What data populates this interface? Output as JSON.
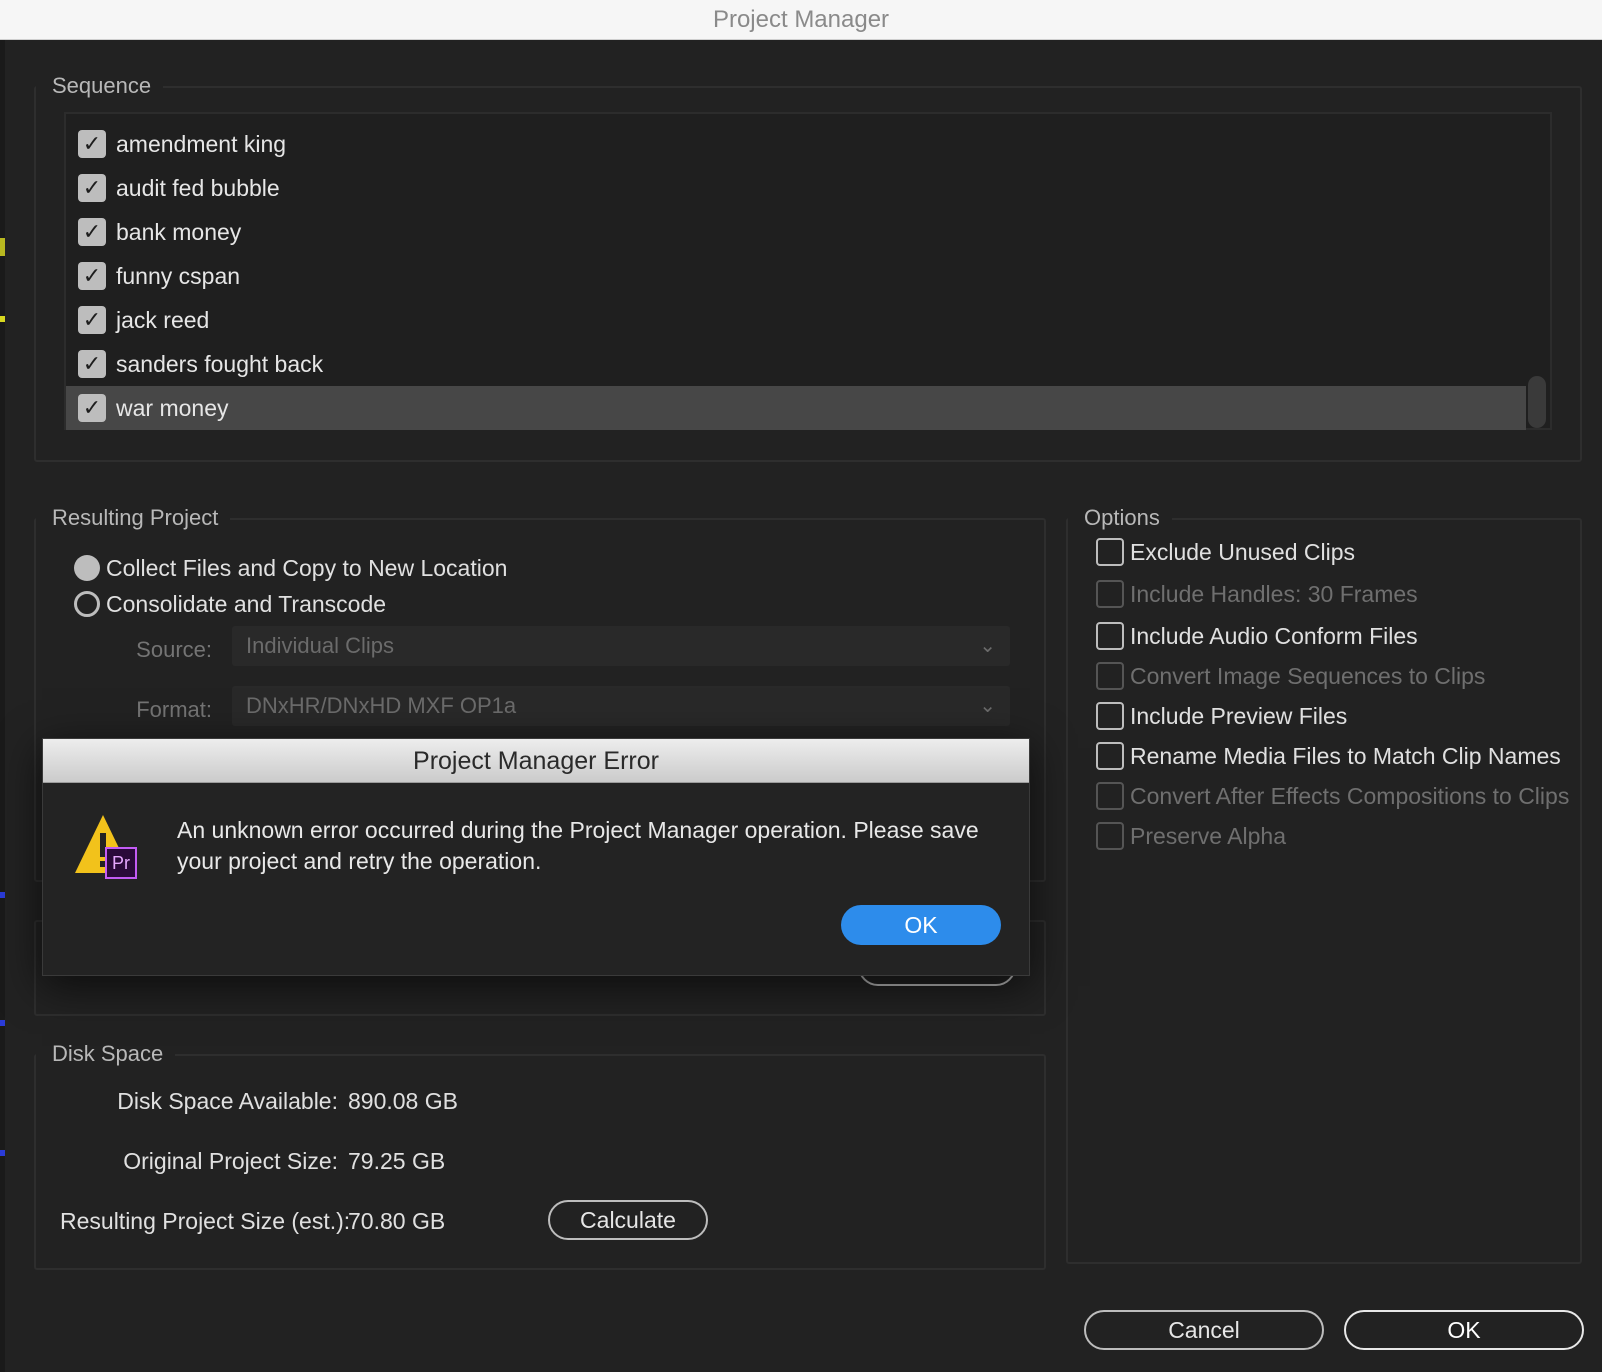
{
  "window": {
    "title": "Project Manager"
  },
  "sequence": {
    "legend": "Sequence",
    "items": [
      {
        "label": "amendment king",
        "checked": true
      },
      {
        "label": "audit fed bubble",
        "checked": true
      },
      {
        "label": "bank money",
        "checked": true
      },
      {
        "label": "funny cspan",
        "checked": true
      },
      {
        "label": "jack reed",
        "checked": true
      },
      {
        "label": "sanders fought back",
        "checked": true
      },
      {
        "label": "war money",
        "checked": true,
        "selected": true
      }
    ]
  },
  "resulting_project": {
    "legend": "Resulting Project",
    "options": [
      {
        "label": "Collect Files and Copy to New Location",
        "selected": true
      },
      {
        "label": "Consolidate and Transcode",
        "selected": false
      }
    ],
    "source_label": "Source:",
    "source_value": "Individual Clips",
    "format_label": "Format:",
    "format_value": "DNxHR/DNxHD MXF OP1a"
  },
  "options": {
    "legend": "Options",
    "items": [
      {
        "label": "Exclude Unused Clips",
        "enabled": true,
        "checked": false
      },
      {
        "label": "Include Handles:  30 Frames",
        "enabled": false,
        "checked": false
      },
      {
        "label": "Include Audio Conform Files",
        "enabled": true,
        "checked": false
      },
      {
        "label": "Convert Image Sequences to Clips",
        "enabled": false,
        "checked": false
      },
      {
        "label": "Include Preview Files",
        "enabled": true,
        "checked": false
      },
      {
        "label": "Rename Media Files to Match Clip Names",
        "enabled": true,
        "checked": false
      },
      {
        "label": "Convert After Effects Compositions to Clips",
        "enabled": false,
        "checked": false
      },
      {
        "label": "Preserve Alpha",
        "enabled": false,
        "checked": false
      }
    ]
  },
  "disk_space": {
    "legend": "Disk Space",
    "available_label": "Disk Space Available:",
    "available_value": "890.08 GB",
    "original_label": "Original Project Size:",
    "original_value": "79.25 GB",
    "resulting_label": "Resulting Project Size (est.):",
    "resulting_value": "70.80 GB",
    "calculate_label": "Calculate"
  },
  "footer": {
    "cancel_label": "Cancel",
    "ok_label": "OK"
  },
  "error_dialog": {
    "title": "Project Manager Error",
    "message": "An unknown error occurred during the Project Manager operation. Please save your project and retry the operation.",
    "ok_label": "OK",
    "badge": "Pr",
    "accent_color": "#2d8ceb",
    "warning_color": "#f2c21b",
    "badge_color": "#2a0a3a"
  }
}
